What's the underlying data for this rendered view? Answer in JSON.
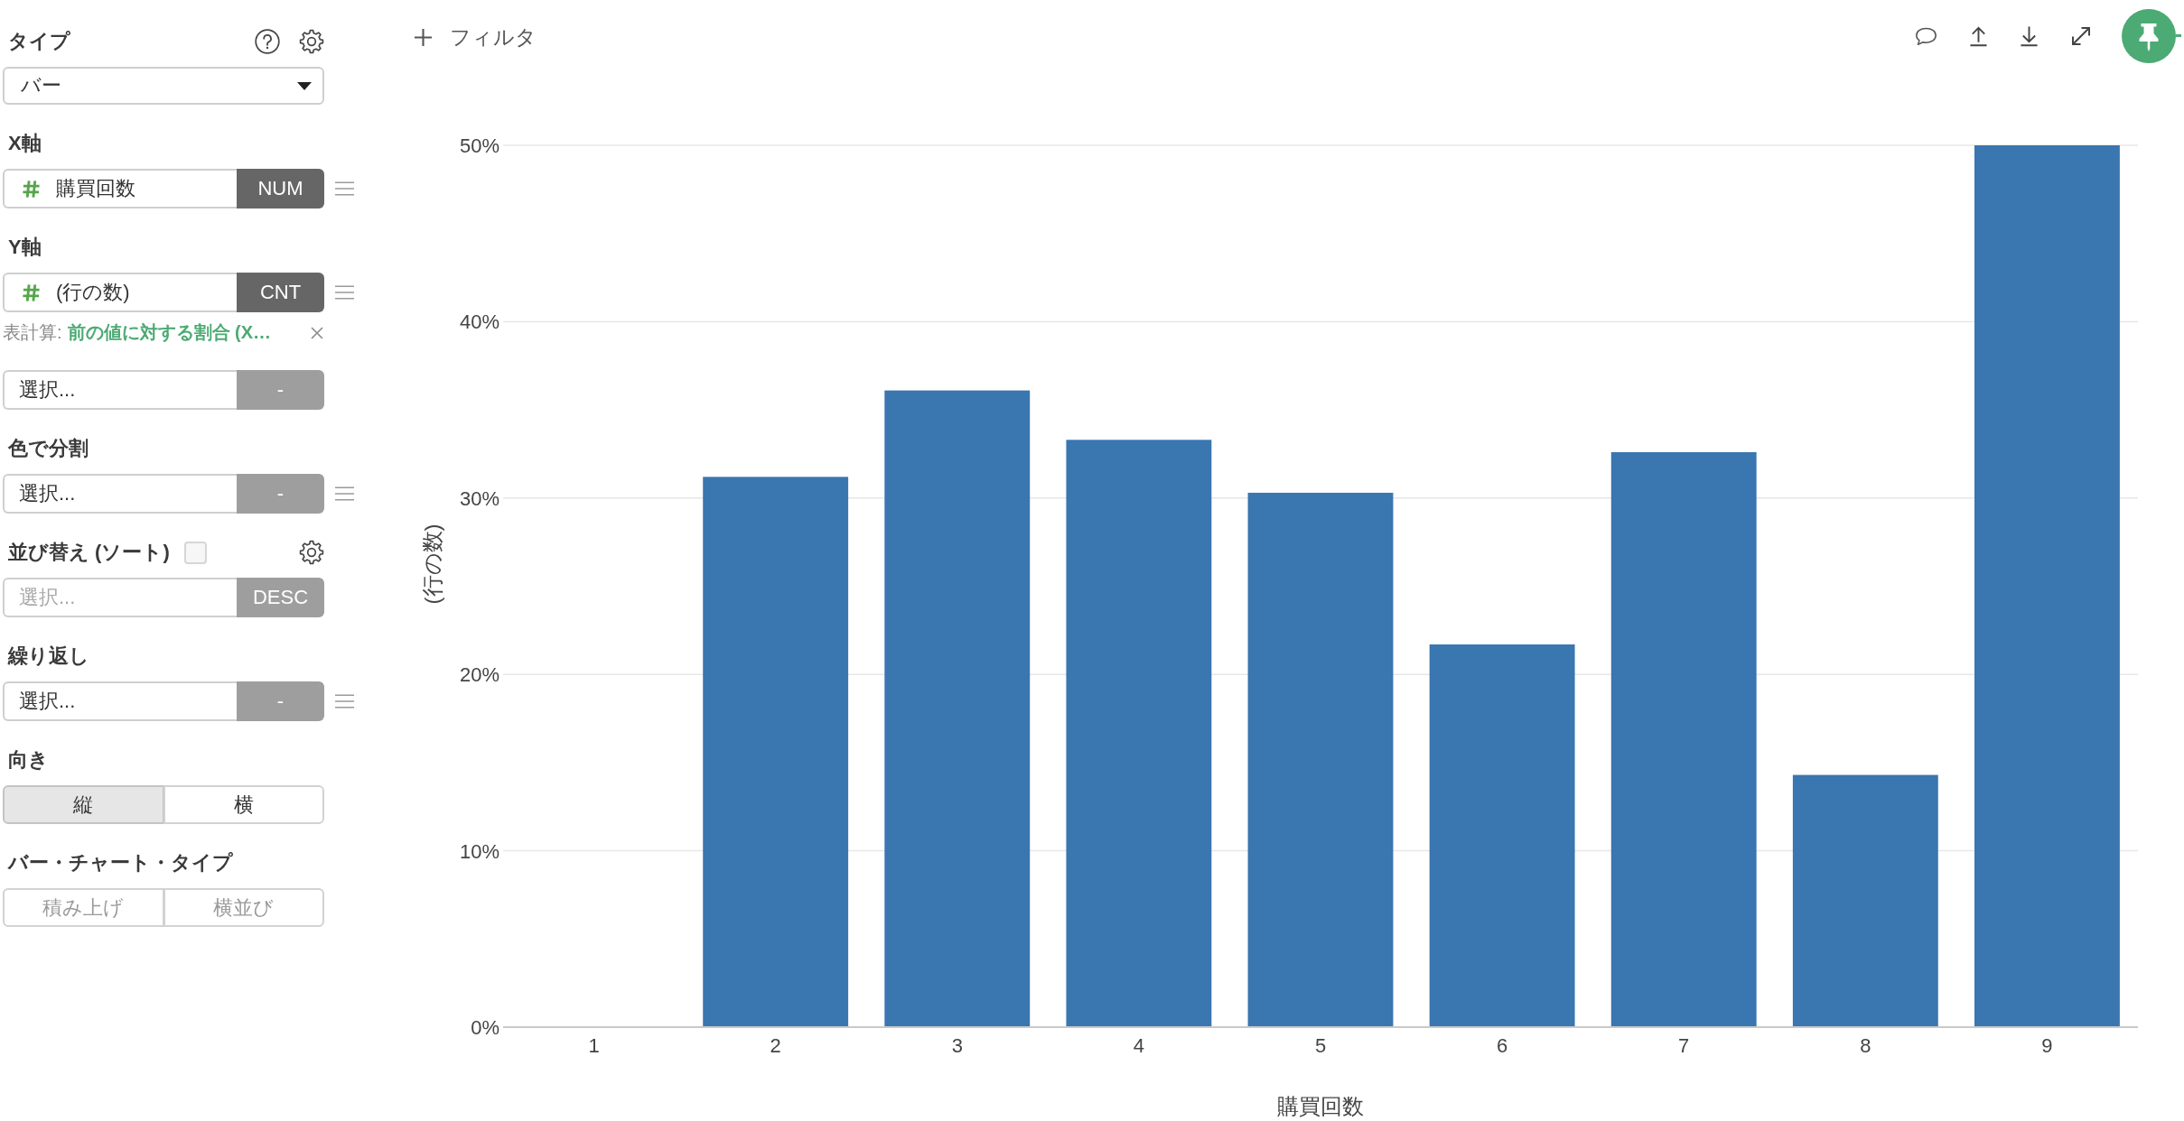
{
  "sidebar": {
    "sections": [
      {
        "kind": "dropdown",
        "label": "タイプ",
        "value": "バー"
      },
      {
        "kind": "field",
        "label": "X軸",
        "numeric": true,
        "value": "購買回数",
        "aggregate": {
          "label": "NUM",
          "active": true
        },
        "menu": true
      },
      {
        "kind": "field",
        "label": "Y軸",
        "numeric": true,
        "value": "(行の数)",
        "aggregate": {
          "label": "CNT",
          "active": true
        },
        "menu": true,
        "calc": {
          "label": "表計算:",
          "value": "前の値に対する割合 (X…"
        }
      },
      {
        "kind": "field",
        "numeric": false,
        "value": "選択...",
        "aggregate": {
          "label": "-",
          "active": false
        },
        "menu": false
      },
      {
        "kind": "field",
        "label": "色で分割",
        "numeric": false,
        "value": "選択...",
        "aggregate": {
          "label": "-",
          "active": false
        },
        "menu": true
      },
      {
        "kind": "sort",
        "label": "並び替え (ソート)",
        "checked": false,
        "placeholder": "選択...",
        "aggregate": {
          "label": "DESC",
          "active": false
        },
        "menu": false
      },
      {
        "kind": "field",
        "label": "繰り返し",
        "numeric": false,
        "value": "選択...",
        "aggregate": {
          "label": "-",
          "active": false
        },
        "menu": true
      },
      {
        "kind": "segmented",
        "label": "向き",
        "disabled": false,
        "options": [
          {
            "label": "縦",
            "selected": true
          },
          {
            "label": "横",
            "selected": false
          }
        ]
      },
      {
        "kind": "segmented",
        "label": "バー・チャート・タイプ",
        "disabled": true,
        "options": [
          {
            "label": "積み上げ",
            "selected": false
          },
          {
            "label": "横並び",
            "selected": false
          }
        ]
      }
    ]
  },
  "toolbar": {
    "filter_button": "フィルタ",
    "pinned": true
  },
  "chart": {
    "chart_data": {
      "type": "bar",
      "xlabel": "購買回数",
      "ylabel": "(行の数)",
      "categories": [
        "1",
        "2",
        "3",
        "4",
        "5",
        "6",
        "7",
        "8",
        "9"
      ],
      "values": [
        0,
        31.2,
        36.1,
        33.3,
        30.3,
        21.7,
        32.6,
        14.3,
        50
      ],
      "ylim": [
        0,
        50
      ],
      "yticks": [
        {
          "value": 0,
          "label": "0%"
        },
        {
          "value": 10,
          "label": "10%"
        },
        {
          "value": 20,
          "label": "20%"
        },
        {
          "value": 30,
          "label": "30%"
        },
        {
          "value": 40,
          "label": "40%"
        },
        {
          "value": 50,
          "label": "50%"
        }
      ],
      "grid": true
    }
  }
}
